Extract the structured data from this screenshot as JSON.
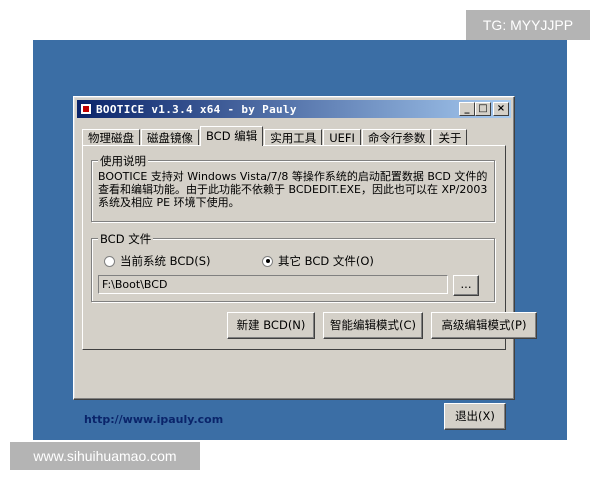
{
  "overlays": {
    "top_badge": "TG: MYYJJPP",
    "bottom_badge": "www.sihuihuamao.com"
  },
  "window": {
    "title": "BOOTICE v1.3.4 x64 - by Pauly",
    "minimize_glyph": "_",
    "maximize_glyph": "□",
    "close_glyph": "×"
  },
  "tabs": [
    {
      "label": "物理磁盘",
      "active": false
    },
    {
      "label": "磁盘镜像",
      "active": false
    },
    {
      "label": "BCD 编辑",
      "active": true
    },
    {
      "label": "实用工具",
      "active": false
    },
    {
      "label": "UEFI",
      "active": false
    },
    {
      "label": "命令行参数",
      "active": false
    },
    {
      "label": "关于",
      "active": false
    }
  ],
  "usage": {
    "title": "使用说明",
    "text": "BOOTICE 支持对 Windows Vista/7/8 等操作系统的启动配置数据 BCD 文件的查看和编辑功能。由于此功能不依赖于 BCDEDIT.EXE，因此也可以在 XP/2003 系统及相应 PE 环境下使用。"
  },
  "bcd_file": {
    "title": "BCD 文件",
    "option_current": "当前系统 BCD(S)",
    "option_other": "其它 BCD 文件(O)",
    "path_value": "F:\\Boot\\BCD",
    "browse_label": "..."
  },
  "actions": {
    "new_bcd": "新建 BCD(N)",
    "smart_edit": "智能编辑模式(C)",
    "advanced_edit": "高级编辑模式(P)"
  },
  "footer": {
    "link": "http://www.ipauly.com",
    "exit": "退出(X)"
  }
}
